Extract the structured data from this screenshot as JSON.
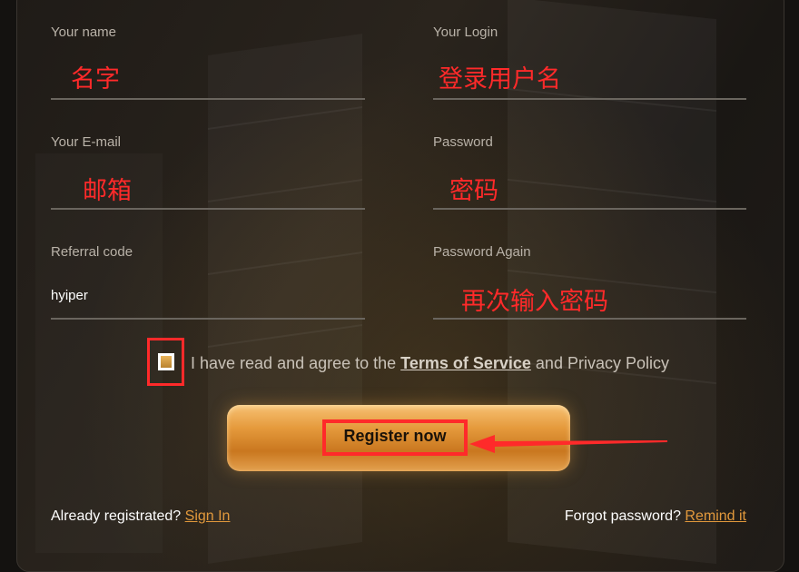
{
  "form": {
    "name": {
      "label": "Your name",
      "annotation": "名字"
    },
    "login": {
      "label": "Your Login",
      "annotation": "登录用户名"
    },
    "email": {
      "label": "Your E-mail",
      "annotation": "邮箱"
    },
    "password": {
      "label": "Password",
      "annotation": "密码"
    },
    "referral": {
      "label": "Referral code",
      "value": "hyiper"
    },
    "password_again": {
      "label": "Password Again",
      "annotation": "再次输入密码"
    }
  },
  "agreement": {
    "prefix": "I have read and agree to the ",
    "terms_link": "Terms of Service",
    "suffix": " and Privacy Policy",
    "checked": true
  },
  "register_button": {
    "label": "Register now"
  },
  "footer": {
    "already_text": "Already registrated? ",
    "sign_in_link": "Sign In",
    "forgot_text": "Forgot password? ",
    "remind_link": "Remind it"
  },
  "colors": {
    "annotation_red": "#ff2a2a",
    "accent_gold": "#e2993c",
    "background": "#141210"
  },
  "icons": {
    "checkbox": "checkbox-icon",
    "arrow": "arrow-left-icon"
  }
}
